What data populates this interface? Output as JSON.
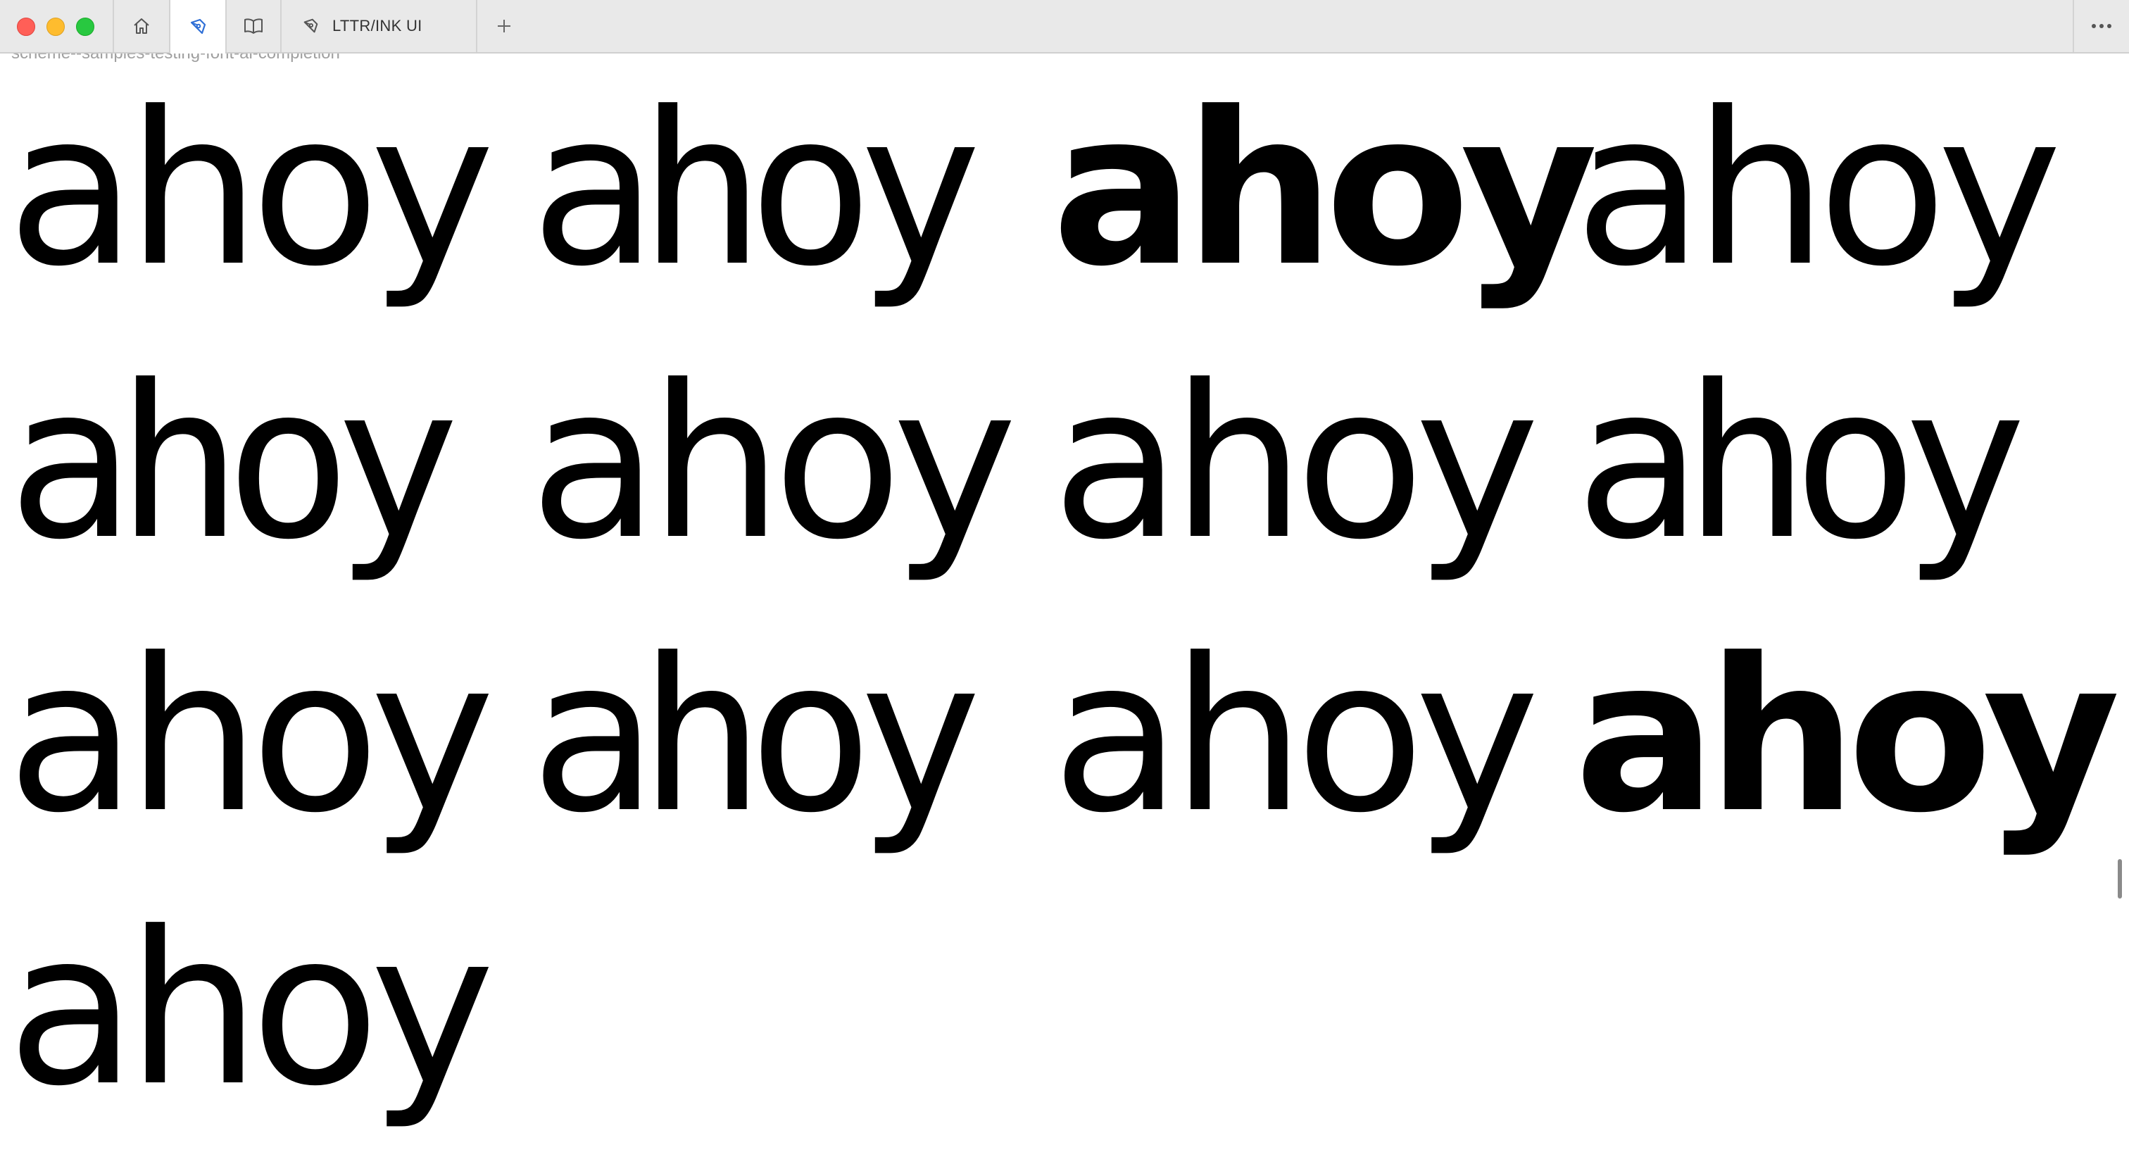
{
  "window": {
    "traffic_lights": [
      "close",
      "minimize",
      "zoom"
    ],
    "colors": {
      "close": "#ff5f57",
      "minimize": "#febc2e",
      "zoom": "#28c840",
      "accent": "#2f6fd6"
    }
  },
  "tabs": {
    "home_icon": "home-icon",
    "pen_icon": "pen-nib-icon",
    "book_icon": "book-open-icon",
    "document": {
      "icon": "pen-nib-icon",
      "label": "LTTR/INK UI"
    },
    "add_icon": "plus-icon",
    "more_icon": "ellipsis-icon"
  },
  "content": {
    "scheme_name": "scheme--samples-testing-font-ai-completion",
    "specimen_rows": [
      [
        "ahoy",
        "ahoy",
        "ahoy",
        "ahoy"
      ],
      [
        "ahoy",
        "ahoy",
        "ahoy",
        "ahoy"
      ],
      [
        "ahoy",
        "ahoy",
        "ahoy",
        "ahoy"
      ],
      [
        "ahoy"
      ]
    ]
  }
}
